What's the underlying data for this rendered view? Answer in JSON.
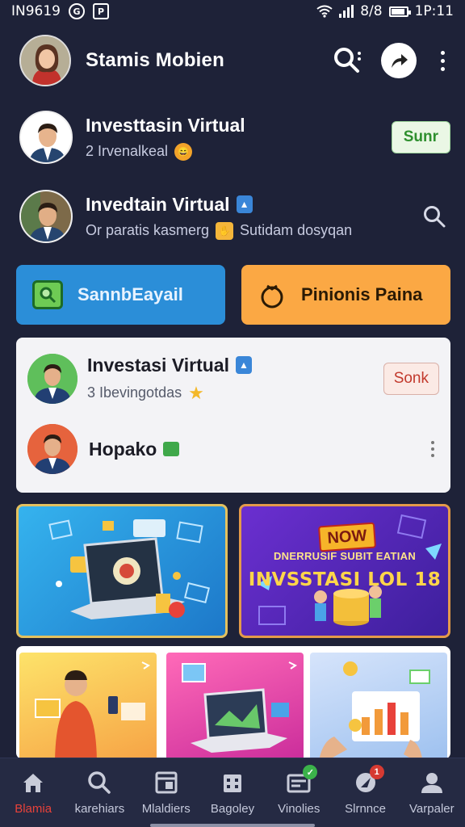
{
  "status_bar": {
    "left_text": "IN9619",
    "time": "1P:11",
    "battery_text": "8/8"
  },
  "header": {
    "title": "Stamis Mobien"
  },
  "rows": [
    {
      "title": "Investtasin Virtual",
      "subtitle": "2  Irvenalkeal",
      "button_label": "Sunr"
    },
    {
      "title": "Invedtain Virtual",
      "subtitle_a": "Or paratis kasmerg",
      "subtitle_b": "Sutidam dosyqan"
    }
  ],
  "actions": {
    "primary_label": "SannbEayail",
    "secondary_label": "Pinionis Paina"
  },
  "card": {
    "item1": {
      "title": "Investasi Virtual",
      "subtitle": "3  Ibevingotdas",
      "button_label": "Sonk"
    },
    "item2": {
      "title": "Hopako"
    }
  },
  "banners": {
    "promo": {
      "badge": "NOW",
      "subtitle": "DNERRUSIF SUBIT EATIAN",
      "title": "INVSSTASI LOL 18"
    }
  },
  "bottom_nav": {
    "items": [
      {
        "label": "Blamia",
        "icon": "home-icon",
        "active": true
      },
      {
        "label": "karehiars",
        "icon": "search-icon"
      },
      {
        "label": "Mlaldiers",
        "icon": "window-icon"
      },
      {
        "label": "Bagoley",
        "icon": "building-icon"
      },
      {
        "label": "Vinolies",
        "icon": "dashboard-icon"
      },
      {
        "label": "Slrnnce",
        "icon": "rocket-icon"
      },
      {
        "label": "Varpaler",
        "icon": "person-icon"
      }
    ]
  },
  "colors": {
    "background": "#1e2238",
    "accent_blue": "#2b8ed8",
    "accent_orange": "#fba844",
    "active_nav": "#e8423a"
  }
}
